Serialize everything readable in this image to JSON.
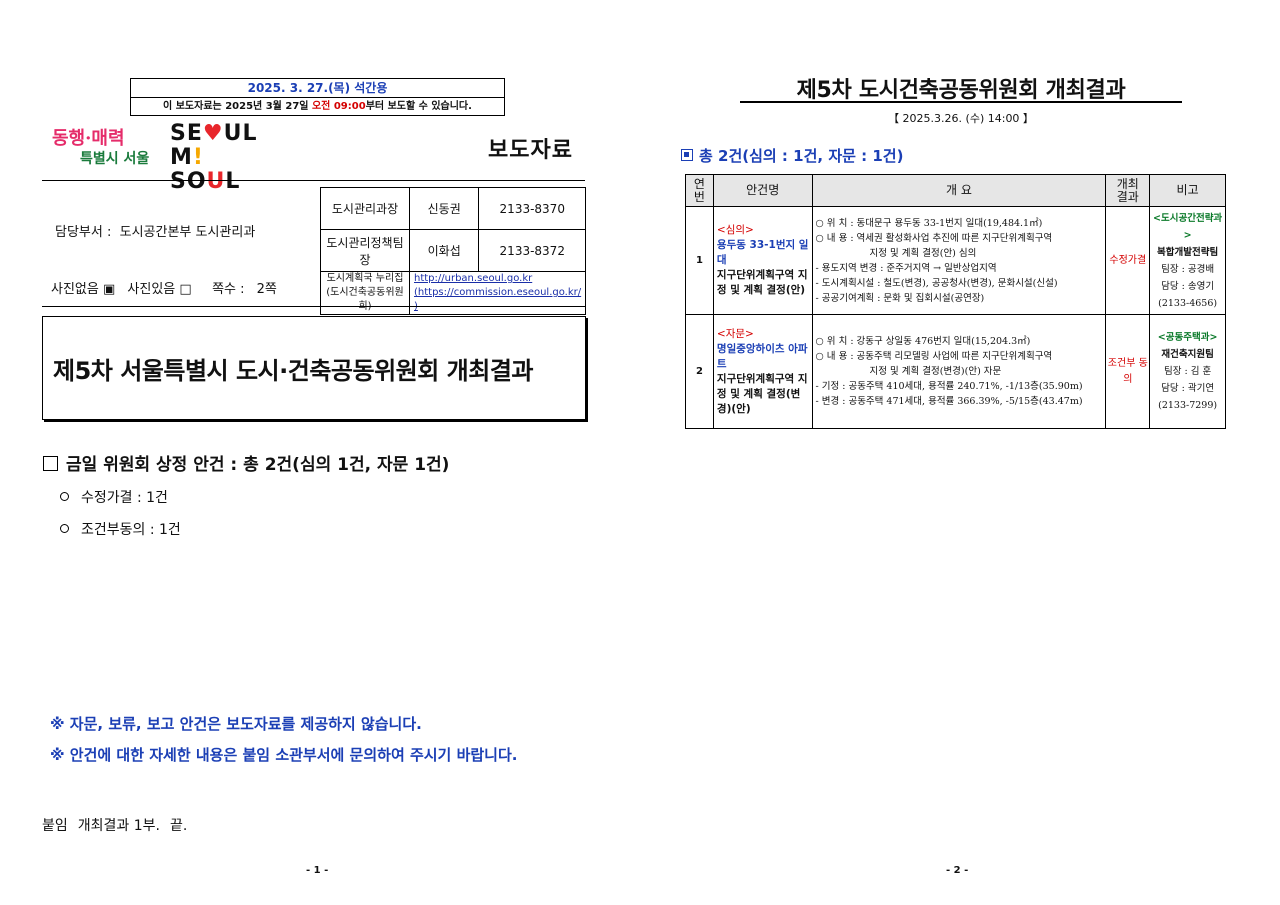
{
  "page1": {
    "embargo": {
      "date": "2025. 3. 27.(목) 석간용",
      "note_pre": "이 보도자료는 2025년 3월 27일 ",
      "note_red": "오전 09:00",
      "note_post": "부터 보도할 수 있습니다."
    },
    "logo": {
      "slogan_line1": "동행·매력",
      "slogan_line2": "특별시 서울",
      "seoul_line1": "SEOUL",
      "seoul_line2": "MY SOUL"
    },
    "press_label": "보도자료",
    "dept_label": "담당부서 :",
    "dept_value": "도시공간본부 도시관리과",
    "photo": {
      "no_photo": "사진없음 ▣",
      "with_photo": "사진있음 □",
      "pages_label": "쪽수 :",
      "pages_value": "2쪽"
    },
    "contacts": [
      {
        "title": "도시관리과장",
        "name": "신동권",
        "phone": "2133-8370"
      },
      {
        "title": "도시관리정책팀장",
        "name": "이화섭",
        "phone": "2133-8372"
      }
    ],
    "links": {
      "label1": "도시계획국 누리집",
      "label2": "(도시건축공동위원회)",
      "url1": "http://urban.seoul.go.kr",
      "url2": "(https://commission.eseoul.go.kr/ )"
    },
    "headline": "제5차 서울특별시 도시·건축공동위원회 개최결과",
    "agenda_title": "금일 위원회 상정 안건 : 총 2건(심의 1건, 자문 1건)",
    "agenda_items": [
      "수정가결 : 1건",
      "조건부동의 : 1건"
    ],
    "notes": [
      "※ 자문, 보류, 보고 안건은 보도자료를 제공하지 않습니다.",
      "※ 안건에 대한 자세한 내용은 붙임 소관부서에 문의하여 주시기 바랍니다."
    ],
    "attachment": {
      "label": "붙임",
      "text": "개최결과 1부.",
      "end": "끝."
    },
    "page_number": "- 1 -"
  },
  "page2": {
    "title": "제5차 도시건축공동위원회 개최결과",
    "date": "【  2025.3.26. (수) 14:00  】",
    "summary": "총 2건(심의 : 1건, 자문 : 1건)",
    "table": {
      "headers": {
        "no": "연\n번",
        "name": "안건명",
        "desc": "개  요",
        "result": "개최\n결과",
        "note": "비고"
      },
      "rows": [
        {
          "no": "1",
          "category": "<심의>",
          "location": "용두동 33-1번지 일대",
          "name": "지구단위계획구역 지정 및 계획 결정(안)",
          "desc": [
            "○ 위 치 : 동대문구 용두동 33-1번지 일대(19,484.1㎡)",
            "○ 내 용 : 역세권 활성화사업 추진에 따른 지구단위계획구역",
            "지정 및 계획 결정(안) 심의",
            " - 용도지역 변경 : 준주거지역 → 일반상업지역",
            " - 도시계획시설 : 철도(변경), 공공청사(변경), 문화시설(신설)",
            " - 공공기여계획 : 문화 및 집회시설(공연장)"
          ],
          "result": "수정가결",
          "dept": "<도시공간전략과>",
          "team": "복합개발전략팀",
          "leader": "팀장 : 공경배",
          "staff": "담당 : 송영기",
          "phone": "(2133-4656)"
        },
        {
          "no": "2",
          "category": "<자문>",
          "location": "명일중앙하이츠 아파트",
          "name": "지구단위계획구역 지정 및 계획 결정(변경)(안)",
          "desc": [
            "○ 위 치 : 강동구 상일동 476번지 일대(15,204.3㎡)",
            "○ 내 용 : 공동주택 리모델링 사업에 따른 지구단위계획구역",
            "지정 및 계획 결정(변경)(안) 자문",
            " - 기정 : 공동주택 410세대, 용적률 240.71%, -1/13층(35.90m)",
            " - 변경 : 공동주택 471세대, 용적률 366.39%, -5/15층(43.47m)"
          ],
          "result": "조건부 동의",
          "dept": "<공동주택과>",
          "team": "재건축지원팀",
          "leader": "팀장 : 김 훈",
          "staff": "담당 : 곽기연",
          "phone": "(2133-7299)"
        }
      ]
    },
    "page_number": "- 2 -"
  },
  "colors": {
    "blue": "#1b3fb5",
    "red": "#d40000",
    "green": "#0b7a2a",
    "slogan_pink": "#e52c6a"
  }
}
